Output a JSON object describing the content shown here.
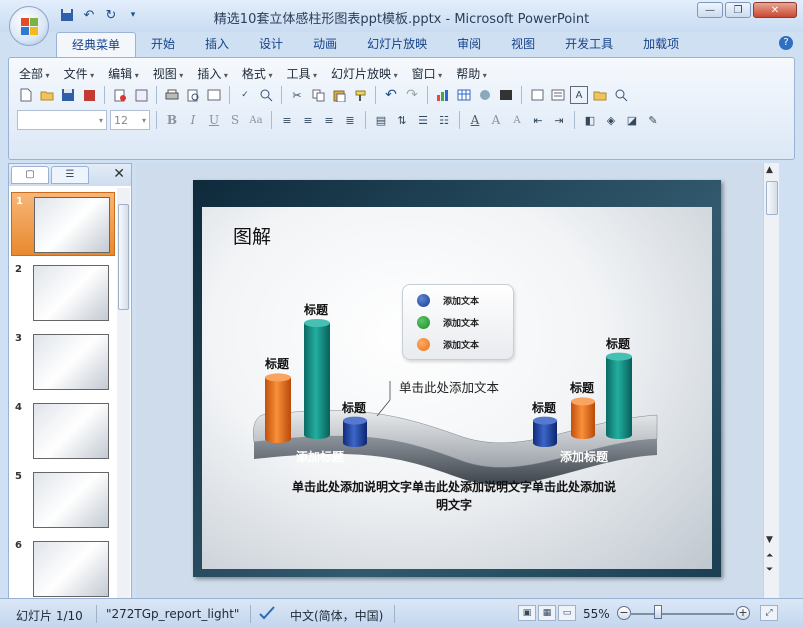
{
  "window": {
    "title": "精选10套立体感柱形图表ppt模板.pptx - Microsoft PowerPoint",
    "controls": {
      "minimize": "—",
      "restore": "❐",
      "close": "✕"
    }
  },
  "qat": [
    "save-icon",
    "undo-icon",
    "redo-icon"
  ],
  "ribbon_tabs": [
    "经典菜单",
    "开始",
    "插入",
    "设计",
    "动画",
    "幻灯片放映",
    "审阅",
    "视图",
    "开发工具",
    "加载项"
  ],
  "ribbon_active_tab": "经典菜单",
  "menu": [
    "全部",
    "文件",
    "编辑",
    "视图",
    "插入",
    "格式",
    "工具",
    "幻灯片放映",
    "窗口",
    "帮助"
  ],
  "format": {
    "font_name": "",
    "font_size": "12"
  },
  "thumbnails": [
    {
      "num": "1"
    },
    {
      "num": "2"
    },
    {
      "num": "3"
    },
    {
      "num": "4"
    },
    {
      "num": "5"
    },
    {
      "num": "6"
    }
  ],
  "slide": {
    "title": "图解",
    "legend": [
      {
        "label": "添加文本",
        "color": "#1a3f8f"
      },
      {
        "label": "添加文本",
        "color": "#1e8a2c"
      },
      {
        "label": "添加文本",
        "color": "#e8731e"
      }
    ],
    "cylinders": [
      {
        "label": "标题",
        "color": "orange",
        "value": 0.55
      },
      {
        "label": "标题",
        "color": "teal",
        "value": 1.0
      },
      {
        "label": "标题",
        "color": "blue",
        "value": 0.2
      },
      {
        "label": "标题",
        "color": "blue",
        "value": 0.2
      },
      {
        "label": "标题",
        "color": "orange",
        "value": 0.3
      },
      {
        "label": "标题",
        "color": "teal",
        "value": 0.7
      }
    ],
    "annotation": "单击此处添加文本",
    "base_labels": [
      "添加标题",
      "添加标题"
    ],
    "description_line1": "单击此处添加说明文字单击此处添加说明文字单击此处添加说",
    "description_line2": "明文字"
  },
  "status": {
    "slide_info": "幻灯片 1/10",
    "theme": "\"272TGp_report_light\"",
    "language": "中文(简体，中国)",
    "zoom": "55%"
  }
}
